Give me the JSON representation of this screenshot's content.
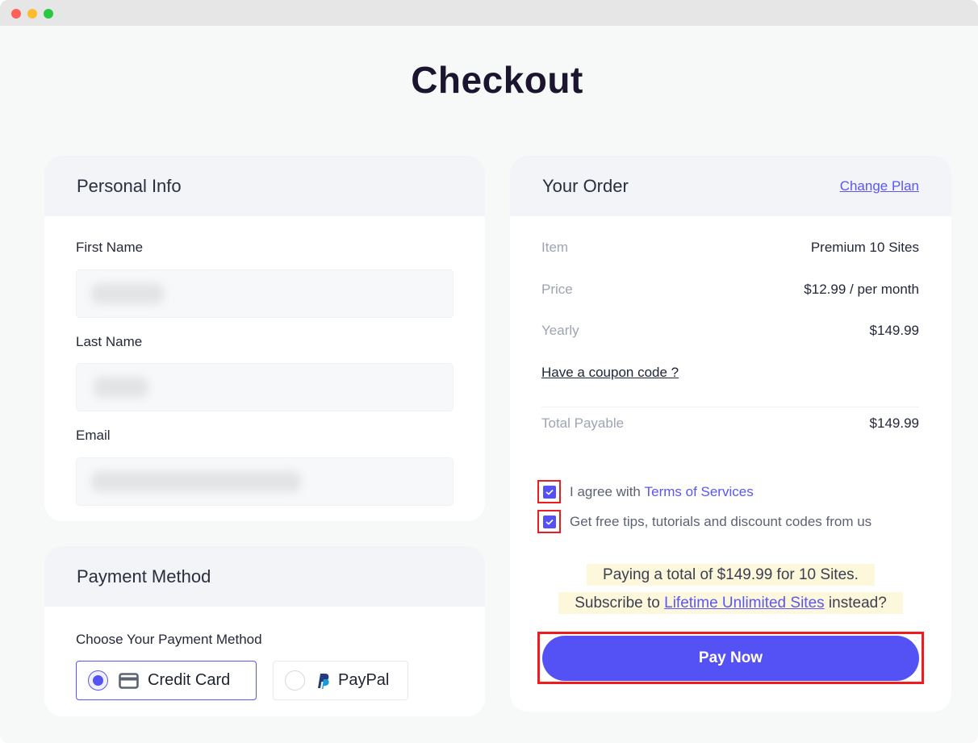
{
  "window": {
    "title": ""
  },
  "page": {
    "title": "Checkout"
  },
  "personal_info": {
    "title": "Personal Info",
    "fields": [
      {
        "label": "First Name",
        "value": "[blurred]"
      },
      {
        "label": "Last Name",
        "value": "[blurred]"
      },
      {
        "label": "Email",
        "value": "[blurred]"
      }
    ]
  },
  "payment_method": {
    "title": "Payment Method",
    "choose_label": "Choose Your Payment Method",
    "options": [
      {
        "label": "Credit Card",
        "icon": "credit-card-icon",
        "selected": true
      },
      {
        "label": "PayPal",
        "icon": "paypal-icon",
        "selected": false
      }
    ]
  },
  "order": {
    "title": "Your Order",
    "change_plan": "Change Plan",
    "rows": [
      {
        "key": "Item",
        "value": "Premium 10 Sites"
      },
      {
        "key": "Price",
        "value": "$12.99 / per month"
      },
      {
        "key": "Yearly",
        "value": "$149.99"
      }
    ],
    "coupon_link": "Have a coupon code ?",
    "total": {
      "key": "Total Payable",
      "value": "$149.99"
    },
    "checks": [
      {
        "text": "I agree with ",
        "link": "Terms of Services",
        "checked": true
      },
      {
        "text": "Get free tips, tutorials and discount codes from us",
        "checked": true
      }
    ],
    "notice_line1": "Paying a total of $149.99 for 10 Sites.",
    "notice_line2_prefix": "Subscribe to ",
    "notice_line2_link": "Lifetime Unlimited Sites",
    "notice_line2_suffix": " instead?",
    "pay_button": "Pay Now"
  },
  "colors": {
    "accent": "#5451f5",
    "highlight_outline": "#ee1c1c",
    "notice_bg": "#fdf8dc"
  }
}
